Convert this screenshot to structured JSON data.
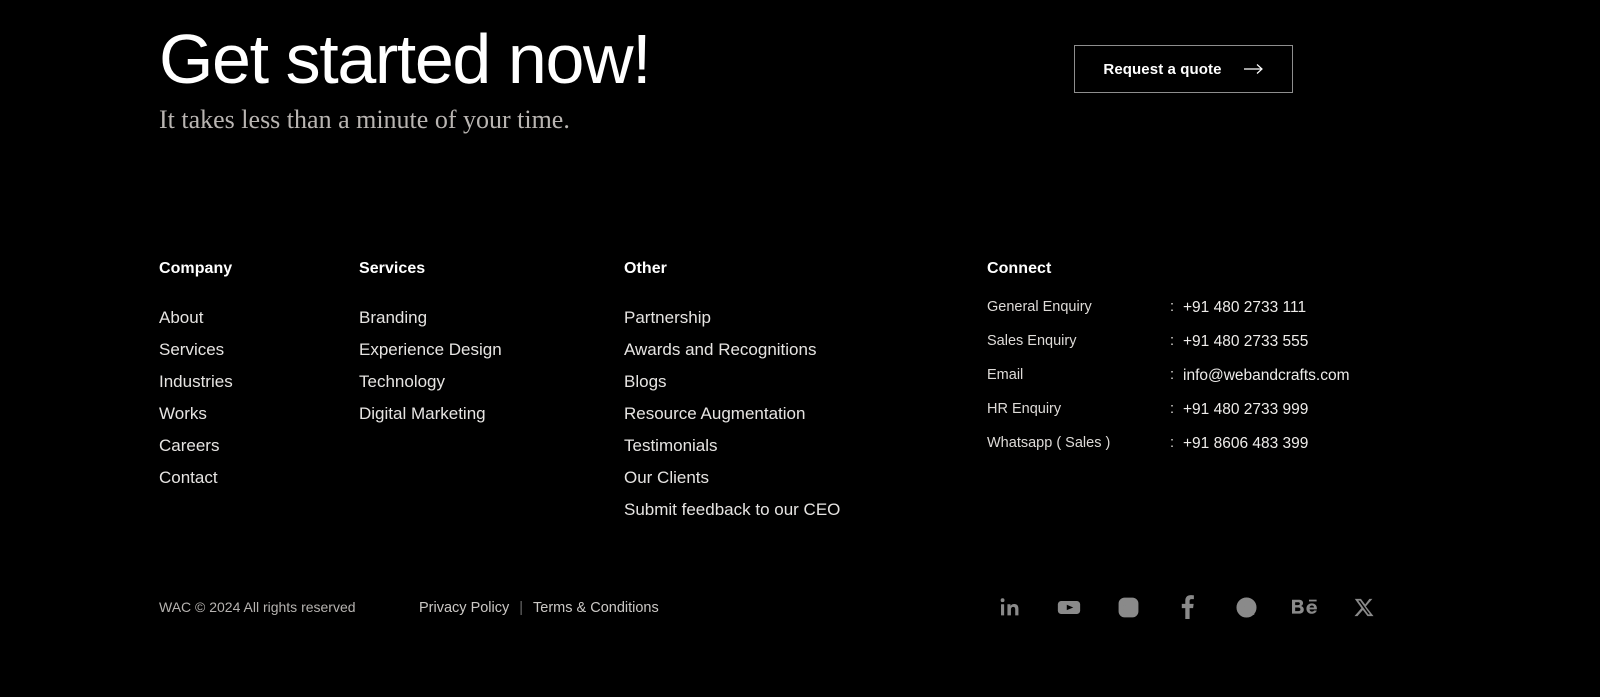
{
  "cta": {
    "title": "Get started now!",
    "subtitle": "It takes less than a minute of your time.",
    "button_label": "Request a quote",
    "button_icon": "arrow-right-icon"
  },
  "footer": {
    "columns": [
      {
        "heading": "Company",
        "items": [
          "About",
          "Services",
          "Industries",
          "Works",
          "Careers",
          "Contact"
        ]
      },
      {
        "heading": "Services",
        "items": [
          "Branding",
          "Experience Design",
          "Technology",
          "Digital Marketing"
        ]
      },
      {
        "heading": "Other",
        "items": [
          "Partnership",
          "Awards and Recognitions",
          "Blogs",
          "Resource Augmentation",
          "Testimonials",
          "Our Clients",
          "Submit feedback to our CEO"
        ]
      }
    ],
    "connect": {
      "heading": "Connect",
      "separator": ":",
      "rows": [
        {
          "label": "General Enquiry",
          "value": "+91 480 2733 111"
        },
        {
          "label": "Sales Enquiry",
          "value": "+91 480 2733 555"
        },
        {
          "label": "Email",
          "value": "info@webandcrafts.com"
        },
        {
          "label": "HR Enquiry",
          "value": "+91 480 2733 999"
        },
        {
          "label": "Whatsapp ( Sales )",
          "value": "+91 8606 483 399"
        }
      ]
    },
    "bottom": {
      "copyright": "WAC © 2024 All rights reserved",
      "privacy_label": "Privacy Policy",
      "separator": "|",
      "terms_label": "Terms & Conditions",
      "socials": [
        "linkedin-icon",
        "youtube-icon",
        "instagram-icon",
        "facebook-icon",
        "dribbble-icon",
        "behance-icon",
        "x-twitter-icon"
      ]
    }
  },
  "colors": {
    "background": "#000000",
    "text_primary": "#ffffff",
    "text_muted": "#b6b3b0",
    "social_icon": "#8a8a8a",
    "button_border": "#8e8e8e"
  }
}
